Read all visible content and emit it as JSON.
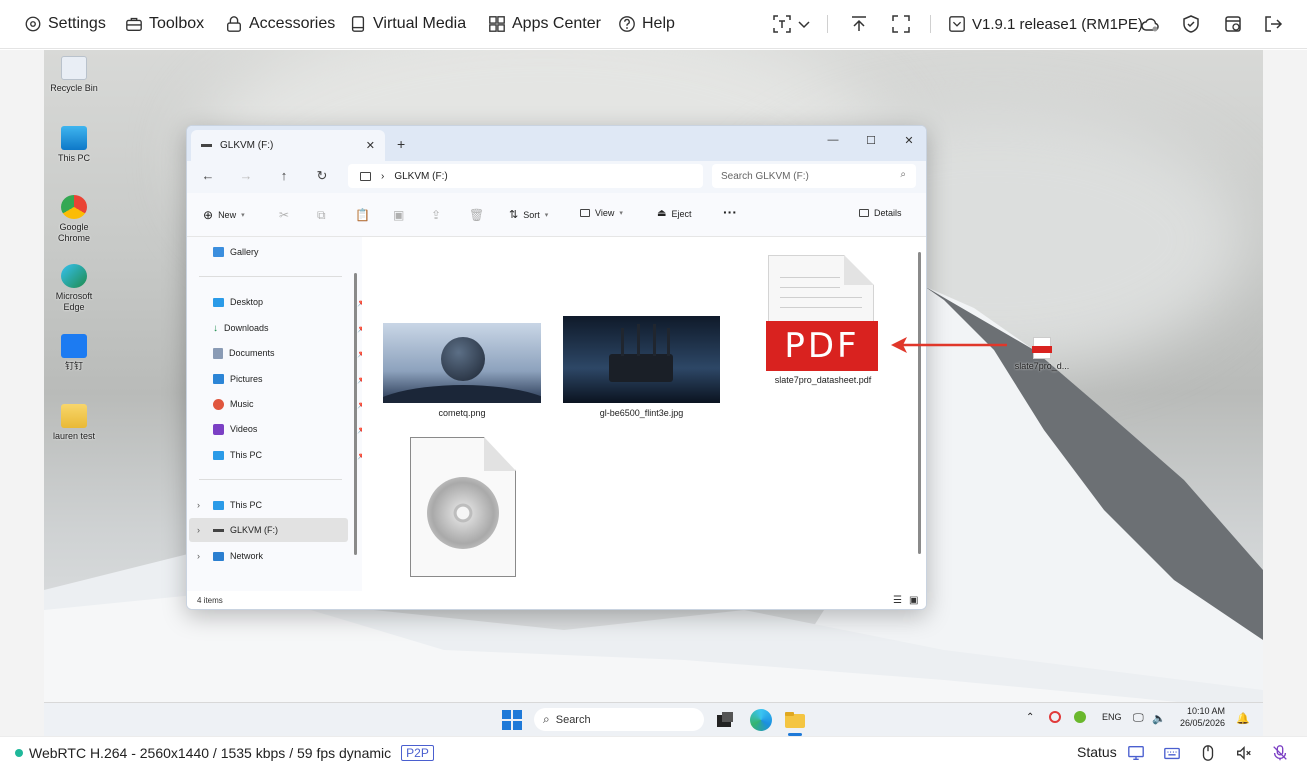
{
  "toolbar": {
    "settings": "Settings",
    "toolbox": "Toolbox",
    "accessories": "Accessories",
    "virtual_media": "Virtual Media",
    "apps_center": "Apps Center",
    "help": "Help",
    "version": "V1.9.1 release1 (RM1PE)"
  },
  "desktop_icons": [
    {
      "label": "Recycle Bin"
    },
    {
      "label": "This PC"
    },
    {
      "label": "Google Chrome"
    },
    {
      "label": "Microsoft Edge"
    },
    {
      "label": "钉钉"
    },
    {
      "label": "lauren test"
    }
  ],
  "explorer": {
    "tab_title": "GLKVM (F:)",
    "address": "GLKVM (F:)",
    "search_placeholder": "Search GLKVM (F:)",
    "commands": {
      "new": "New",
      "sort": "Sort",
      "view": "View",
      "eject": "Eject",
      "details": "Details"
    },
    "nav": {
      "gallery": "Gallery",
      "desktop": "Desktop",
      "downloads": "Downloads",
      "documents": "Documents",
      "pictures": "Pictures",
      "music": "Music",
      "videos": "Videos",
      "this_pc_pinned": "This PC",
      "this_pc": "This PC",
      "glkvm": "GLKVM (F:)",
      "network": "Network"
    },
    "files": [
      {
        "name": "cometq.png"
      },
      {
        "name": "gl-be6500_flint3e.jpg"
      },
      {
        "name": "slate7pro_datasheet.pdf"
      }
    ],
    "status": "4 items"
  },
  "desktop_pdf": {
    "label": "slate7pro_d..."
  },
  "pdf_badge": "PDF",
  "taskbar": {
    "search": "Search",
    "lang": "ENG",
    "time": "10:10 AM",
    "date": "26/05/2026"
  },
  "statusbar": {
    "stream": "WebRTC H.264 - 2560x1440 / 1535 kbps / 59 fps dynamic",
    "mode": "P2P",
    "status": "Status"
  },
  "colors": {
    "accent": "#4a5fcf",
    "status_dot": "#1fb89a",
    "pdf_red": "#d9221f",
    "arrow_red": "#e0372a"
  }
}
